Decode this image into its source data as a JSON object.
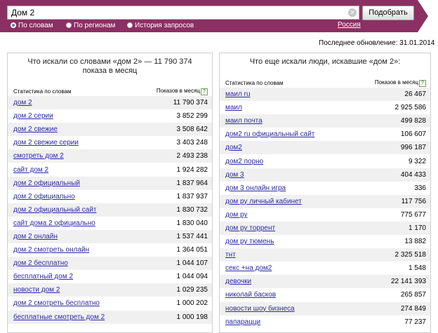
{
  "search": {
    "query": "Дом 2",
    "button_label": "Подобрать",
    "modes": [
      "По словам",
      "По регионам",
      "История запросов"
    ],
    "selected_mode": "По словам",
    "region": "Россия"
  },
  "updated": "Последнее обновление: 31.01.2014",
  "left_panel": {
    "title": "Что искали со словами «дом 2» — 11 790 374 показа в месяц",
    "col_words": "Статистика по словам",
    "col_shows": "Показов в месяц",
    "rows": [
      {
        "phrase": "дом 2",
        "count": "11 790 374"
      },
      {
        "phrase": "дом 2 серии",
        "count": "3 852 299"
      },
      {
        "phrase": "дом 2 свежие",
        "count": "3 508 642"
      },
      {
        "phrase": "дом 2 свежие серии",
        "count": "3 403 248"
      },
      {
        "phrase": "смотреть дом 2",
        "count": "2 493 238"
      },
      {
        "phrase": "сайт дом 2",
        "count": "1 924 282"
      },
      {
        "phrase": "дом 2 официальный",
        "count": "1 837 964"
      },
      {
        "phrase": "дом 2 официально",
        "count": "1 837 937"
      },
      {
        "phrase": "дом 2 официальный сайт",
        "count": "1 830 732"
      },
      {
        "phrase": "сайт дома 2 официально",
        "count": "1 830 040"
      },
      {
        "phrase": "дом 2 онлайн",
        "count": "1 537 441"
      },
      {
        "phrase": "дом 2 смотреть онлайн",
        "count": "1 364 051"
      },
      {
        "phrase": "дом 2 бесплатно",
        "count": "1 044 107"
      },
      {
        "phrase": "бесплатный дом 2",
        "count": "1 044 094"
      },
      {
        "phrase": "новости дом 2",
        "count": "1 029 235"
      },
      {
        "phrase": "дом 2 смотреть бесплатно",
        "count": "1 000 202"
      },
      {
        "phrase": "бесплатные смотреть дом 2",
        "count": "1 000 198"
      }
    ]
  },
  "right_panel": {
    "title": "Что еще искали люди, искавшие «дом 2»:",
    "col_words": "Статистика по словам",
    "col_shows": "Показов в месяц",
    "rows": [
      {
        "phrase": "маил ru",
        "count": "26 467"
      },
      {
        "phrase": "маил",
        "count": "2 925 586"
      },
      {
        "phrase": "маил почта",
        "count": "499 828"
      },
      {
        "phrase": "дом2 ru официальный сайт",
        "count": "106 607"
      },
      {
        "phrase": "дом2",
        "count": "996 187"
      },
      {
        "phrase": "дом2 порно",
        "count": "9 322"
      },
      {
        "phrase": "дом 3",
        "count": "404 433"
      },
      {
        "phrase": "дом 3 онлайн игра",
        "count": "336"
      },
      {
        "phrase": "дом ру личный кабинет",
        "count": "117 756"
      },
      {
        "phrase": "дом ру",
        "count": "775 677"
      },
      {
        "phrase": "дом ру торрент",
        "count": "1 170"
      },
      {
        "phrase": "дом ру тюмень",
        "count": "13 882"
      },
      {
        "phrase": "тнт",
        "count": "2 325 518"
      },
      {
        "phrase": "секс +на дом2",
        "count": "1 548"
      },
      {
        "phrase": "девочки",
        "count": "22 141 393"
      },
      {
        "phrase": "николай басков",
        "count": "265 857"
      },
      {
        "phrase": "новости шоу бизнеса",
        "count": "274 849"
      },
      {
        "phrase": "папарацци",
        "count": "77 237"
      }
    ]
  },
  "icons": {
    "clear": "clear-icon",
    "help": "question-icon"
  },
  "colors": {
    "accent": "#8c2f63",
    "link": "#2a2aa8",
    "zebra": "#f0f0f0"
  }
}
